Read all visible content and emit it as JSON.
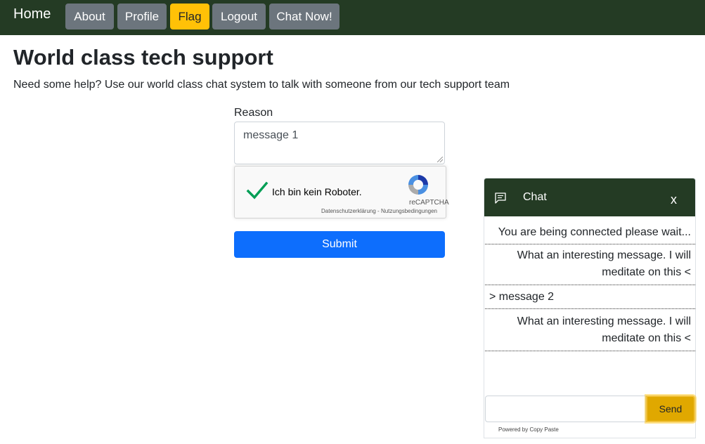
{
  "navbar": {
    "brand": "Home",
    "buttons": [
      {
        "label": "About",
        "style": "secondary"
      },
      {
        "label": "Profile",
        "style": "secondary"
      },
      {
        "label": "Flag",
        "style": "warning"
      },
      {
        "label": "Logout",
        "style": "secondary"
      },
      {
        "label": "Chat Now!",
        "style": "secondary"
      }
    ]
  },
  "page": {
    "title": "World class tech support",
    "lead": "Need some help? Use our world class chat system to talk with someone from our tech support team"
  },
  "form": {
    "reason_label": "Reason",
    "reason_value": "message 1",
    "recaptcha": {
      "label": "Ich bin kein Roboter.",
      "brand": "reCAPTCHA",
      "privacy": "Datenschutzerklärung",
      "separator": " - ",
      "terms": "Nutzungsbedingungen",
      "checked": true
    },
    "submit_label": "Submit"
  },
  "chat": {
    "title": "Chat",
    "close_label": "x",
    "messages": [
      {
        "from": "bot",
        "text": "You are being connected please wait..."
      },
      {
        "from": "bot",
        "text": "What an interesting message. I will meditate on this <"
      },
      {
        "from": "user",
        "text": "> message 2"
      },
      {
        "from": "bot",
        "text": "What an interesting message. I will meditate on this <"
      }
    ],
    "input_value": "",
    "send_label": "Send",
    "powered_by": "Powered by Copy Paste"
  },
  "colors": {
    "navbar_bg": "#243b24",
    "secondary": "#6c757d",
    "warning": "#ffc107",
    "primary": "#0d6efd",
    "recaptcha_check": "#009e55"
  },
  "icons": {
    "chat_header": "chat-bubble-icon",
    "recaptcha_check": "checkmark-icon",
    "recaptcha_logo": "recaptcha-logo-icon"
  }
}
